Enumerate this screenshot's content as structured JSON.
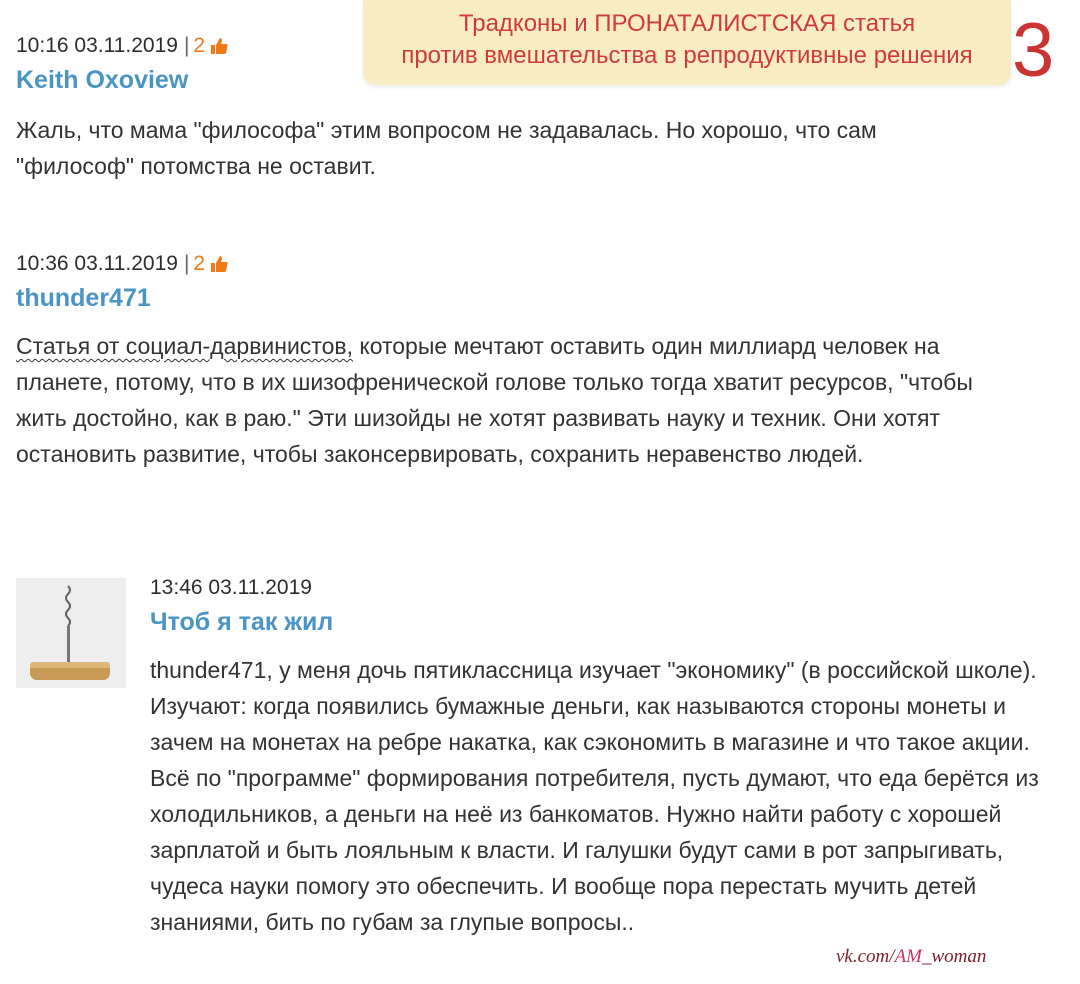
{
  "banner": {
    "line1": "Традконы и ПРОНАТАЛИСТСКАЯ статья",
    "line2": "против вмешательства в репродуктивные решения",
    "page_number": "3"
  },
  "comments": [
    {
      "time": "10:16 03.11.2019",
      "likes": "2",
      "author": "Keith Oxoview",
      "text": "Жаль, что мама \"философа\" этим вопросом не задавалась. Но хорошо, что сам \"философ\" потомства не оставит."
    },
    {
      "time": "10:36 03.11.2019",
      "likes": "2",
      "author": "thunder471",
      "text_underlined": "Статья от социал-дарвинистов,",
      "text_rest": " которые мечтают оставить один миллиард человек на планете, потому, что в их шизофренической голове только тогда хватит ресурсов, \"чтобы жить достойно, как в раю.\" Эти шизойды не хотят развивать науку и техник. Они хотят остановить развитие, чтобы законсервировать, сохранить неравенство людей."
    },
    {
      "time": "13:46 03.11.2019",
      "author": "Чтоб я так жил",
      "text": "thunder471, у меня дочь пятиклассница изучает \"экономику\" (в российской школе). Изучают: когда появились бумажные деньги, как называются стороны монеты и зачем на монетах на ребре накатка, как сэкономить в магазине и что такое акции. Всё по \"программе\" формирования потребителя, пусть думают, что еда берётся из холодильников, а деньги на неё из банкоматов. Нужно найти работу с хорошей зарплатой и быть лояльным к власти. И галушки будут сами в рот запрыгивать, чудеса науки помогу это обеспечить. И вообще пора перестать мучить детей знаниями, бить по губам за глупые вопросы.."
    }
  ],
  "watermark": {
    "prefix": "vk.com/",
    "mid": "AM",
    "suffix": "_woman"
  },
  "colors": {
    "author": "#4a94c6",
    "likes": "#f07a1a",
    "banner_bg": "#f7ecc4",
    "banner_text": "#d13a3a"
  },
  "icons": {
    "like": "thumbs-up-icon"
  }
}
